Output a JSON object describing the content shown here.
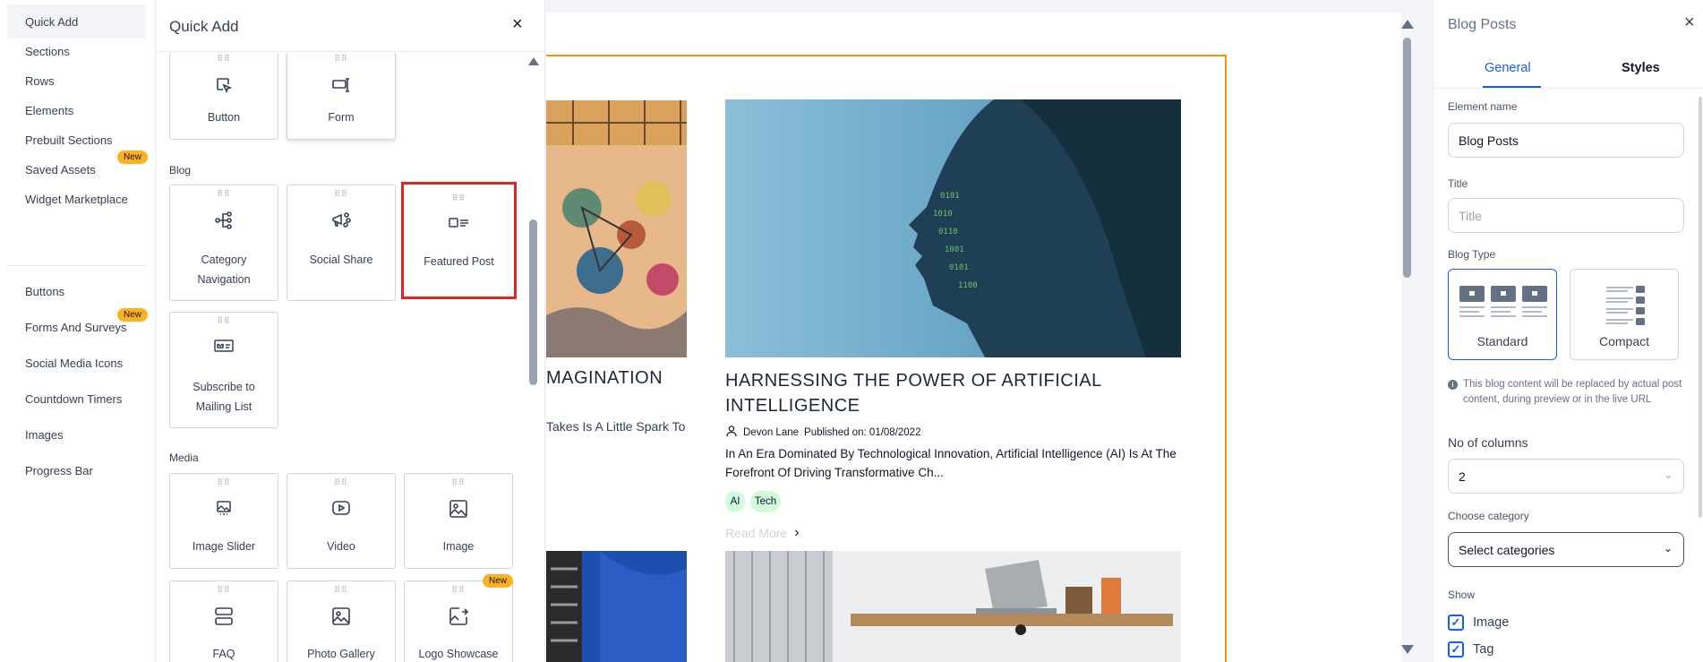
{
  "leftnav": {
    "items": [
      {
        "label": "Quick Add"
      },
      {
        "label": "Sections"
      },
      {
        "label": "Rows"
      },
      {
        "label": "Elements"
      },
      {
        "label": "Prebuilt Sections"
      },
      {
        "label": "Saved Assets",
        "badge": "New"
      },
      {
        "label": "Widget Marketplace"
      },
      {
        "label": "Buttons"
      },
      {
        "label": "Forms And Surveys",
        "badge": "New"
      },
      {
        "label": "Social Media Icons"
      },
      {
        "label": "Countdown Timers"
      },
      {
        "label": "Images"
      },
      {
        "label": "Progress Bar"
      }
    ]
  },
  "quickadd": {
    "title": "Quick Add",
    "close_icon": "×",
    "grip": "⠿⠿",
    "tiles_top": [
      {
        "label": "Button"
      },
      {
        "label": "Form"
      }
    ],
    "blog_label": "Blog",
    "blog_tiles": [
      {
        "label": "Category Navigation"
      },
      {
        "label": "Social Share"
      },
      {
        "label": "Featured Post"
      },
      {
        "label": "Subscribe to Mailing List"
      }
    ],
    "media_label": "Media",
    "media_tiles": [
      {
        "label": "Image Slider"
      },
      {
        "label": "Video"
      },
      {
        "label": "Image"
      },
      {
        "label": "FAQ"
      },
      {
        "label": "Photo Gallery"
      },
      {
        "label": "Logo Showcase",
        "badge": "New"
      }
    ]
  },
  "canvas": {
    "post_a": {
      "title": "MAGINATION",
      "desc": "Takes Is A Little Spark To"
    },
    "post_b": {
      "title": "HARNESSING THE POWER OF ARTIFICIAL INTELLIGENCE",
      "author": "Devon Lane",
      "published": "Published on: 01/08/2022",
      "desc": "In An Era Dominated By Technological Innovation, Artificial Intelligence (AI) Is At The Forefront Of Driving Transformative Ch...",
      "tags": [
        "AI",
        "Tech"
      ],
      "read_more": "Read More",
      "read_more_icon": "›"
    }
  },
  "rightpanel": {
    "title": "Blog Posts",
    "close_icon": "×",
    "tabs": [
      {
        "label": "General"
      },
      {
        "label": "Styles"
      }
    ],
    "element_name_label": "Element name",
    "element_name_value": "Blog Posts",
    "title_label": "Title",
    "title_placeholder": "Title",
    "blog_type_label": "Blog Type",
    "blog_types": [
      {
        "label": "Standard"
      },
      {
        "label": "Compact"
      }
    ],
    "info_note": "This blog content will be replaced by actual post content, during preview or in the live URL",
    "info_icon": "i",
    "columns_label": "No of columns",
    "columns_value": "2",
    "category_label": "Choose category",
    "category_value": "Select categories",
    "chevron": "⌄",
    "show_label": "Show",
    "show_items": [
      {
        "label": "Image",
        "check": "✓"
      },
      {
        "label": "Tag",
        "check": "✓"
      }
    ]
  },
  "colors": {
    "accent": "#155eef",
    "highlight": "#e02424",
    "badge": "#fdb022",
    "frame": "#f79009",
    "tag_bg": "#d1fadf"
  }
}
